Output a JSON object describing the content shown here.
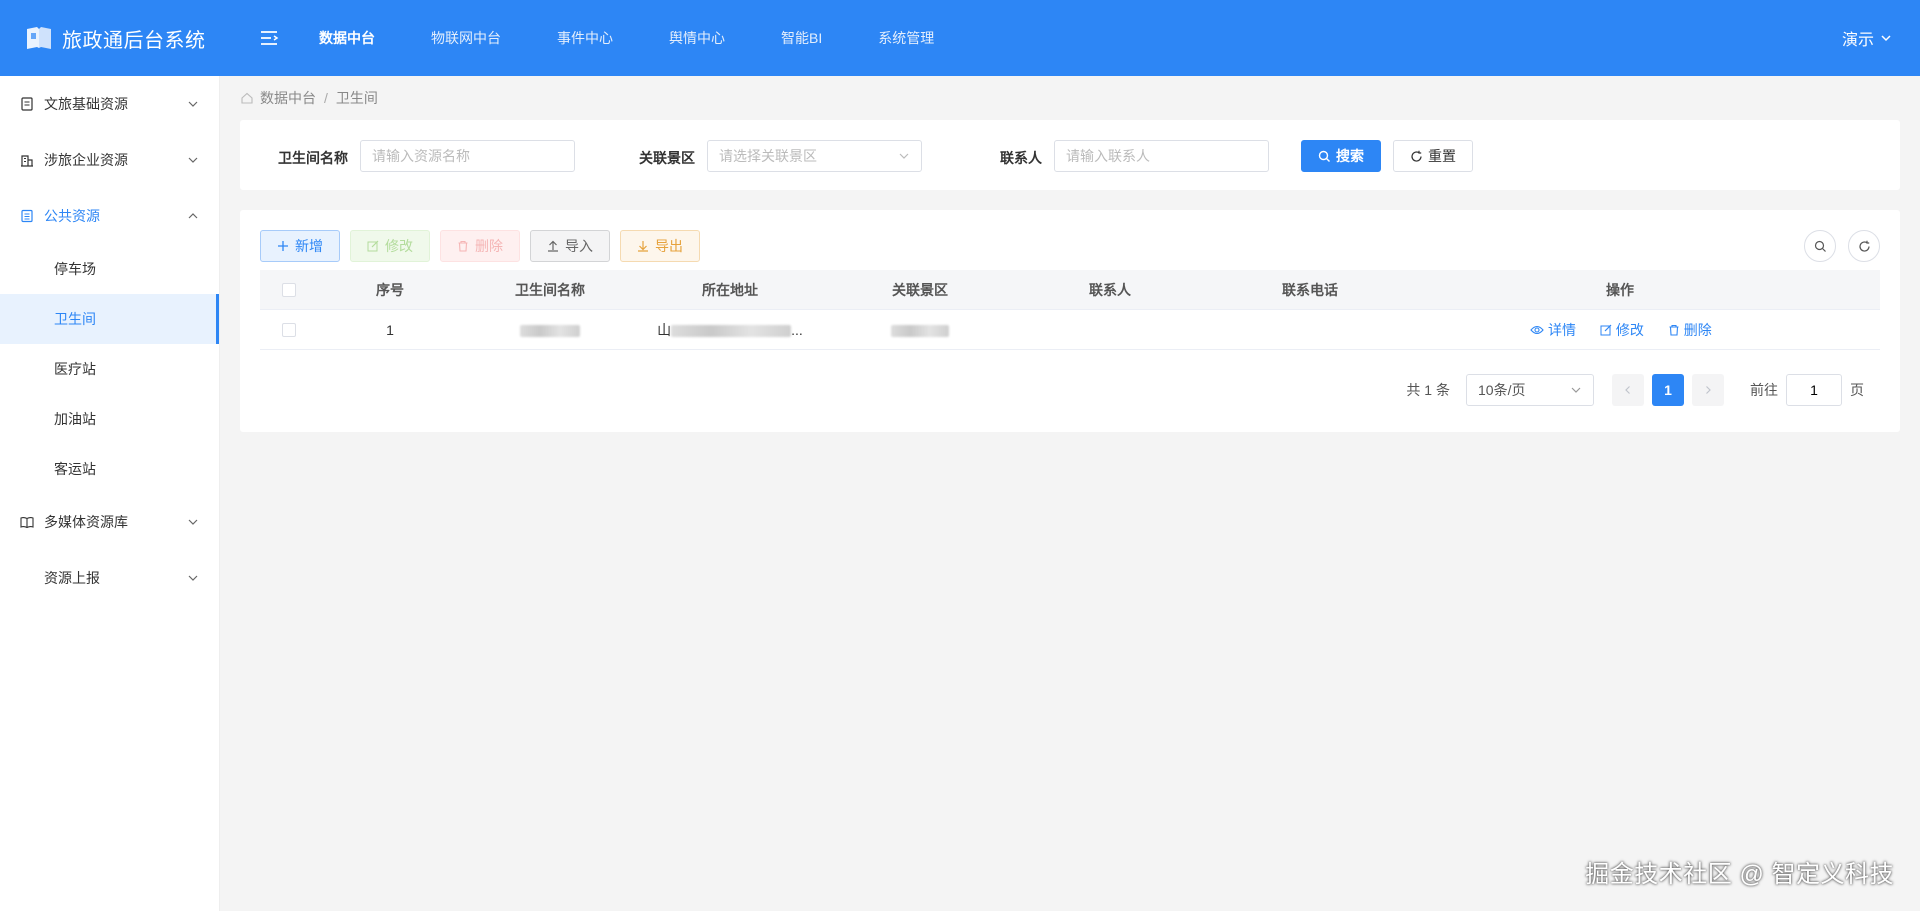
{
  "app": {
    "title": "旅政通后台系统"
  },
  "topnav": [
    {
      "label": "数据中台",
      "active": true
    },
    {
      "label": "物联网中台"
    },
    {
      "label": "事件中心"
    },
    {
      "label": "舆情中心"
    },
    {
      "label": "智能BI"
    },
    {
      "label": "系统管理"
    }
  ],
  "user": {
    "name": "演示"
  },
  "sidebar": {
    "groups": [
      {
        "label": "文旅基础资源"
      },
      {
        "label": "涉旅企业资源"
      },
      {
        "label": "公共资源"
      },
      {
        "label": "多媒体资源库"
      },
      {
        "label": "资源上报"
      }
    ],
    "sub_items": [
      {
        "label": "停车场"
      },
      {
        "label": "卫生间"
      },
      {
        "label": "医疗站"
      },
      {
        "label": "加油站"
      },
      {
        "label": "客运站"
      }
    ]
  },
  "breadcrumb": {
    "parent": "数据中台",
    "sep": "/",
    "current": "卫生间"
  },
  "search": {
    "name_label": "卫生间名称",
    "name_placeholder": "请输入资源名称",
    "area_label": "关联景区",
    "area_placeholder": "请选择关联景区",
    "contact_label": "联系人",
    "contact_placeholder": "请输入联系人",
    "search_btn": "搜索",
    "reset_btn": "重置"
  },
  "toolbar": {
    "add": "新增",
    "edit": "修改",
    "delete": "删除",
    "import": "导入",
    "export": "导出"
  },
  "table": {
    "headers": [
      "序号",
      "卫生间名称",
      "所在地址",
      "关联景区",
      "联系人",
      "联系电话",
      "操作"
    ],
    "rows": [
      {
        "index": "1",
        "name": "",
        "address_prefix": "山",
        "address_suffix": "...",
        "area": "",
        "contact": "",
        "phone": ""
      }
    ],
    "row_actions": {
      "detail": "详情",
      "edit": "修改",
      "delete": "删除"
    }
  },
  "pagination": {
    "total": "共 1 条",
    "page_size": "10条/页",
    "current": "1",
    "goto_label": "前往",
    "goto_value": "1",
    "page_unit": "页"
  },
  "watermark": "掘金技术社区 @ 智定义科技"
}
